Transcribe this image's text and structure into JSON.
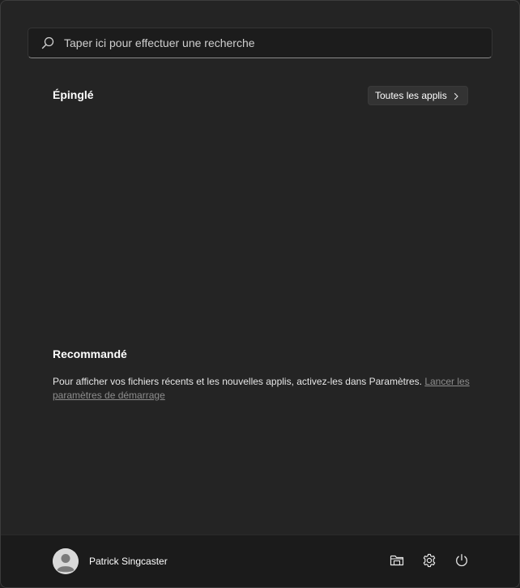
{
  "search": {
    "placeholder": "Taper ici pour effectuer une recherche",
    "icon": "search-icon"
  },
  "pinned": {
    "title": "Épinglé",
    "all_apps_label": "Toutes les applis",
    "all_apps_icon": "chevron-right-icon"
  },
  "recommended": {
    "title": "Recommandé",
    "message": "Pour afficher vos fichiers récents et les nouvelles applis, activez-les dans Paramètres. ",
    "link_label": "Lancer les paramètres de démarrage"
  },
  "footer": {
    "user_name": "Patrick Singcaster",
    "avatar_icon": "user-avatar-icon",
    "icons": [
      "file-explorer-icon",
      "settings-gear-icon",
      "power-icon"
    ]
  },
  "colors": {
    "background": "#242424",
    "footer": "#1b1b1b",
    "search_bg": "#1c1c1c",
    "button_bg": "#333333",
    "link": "#8d8d8d"
  }
}
